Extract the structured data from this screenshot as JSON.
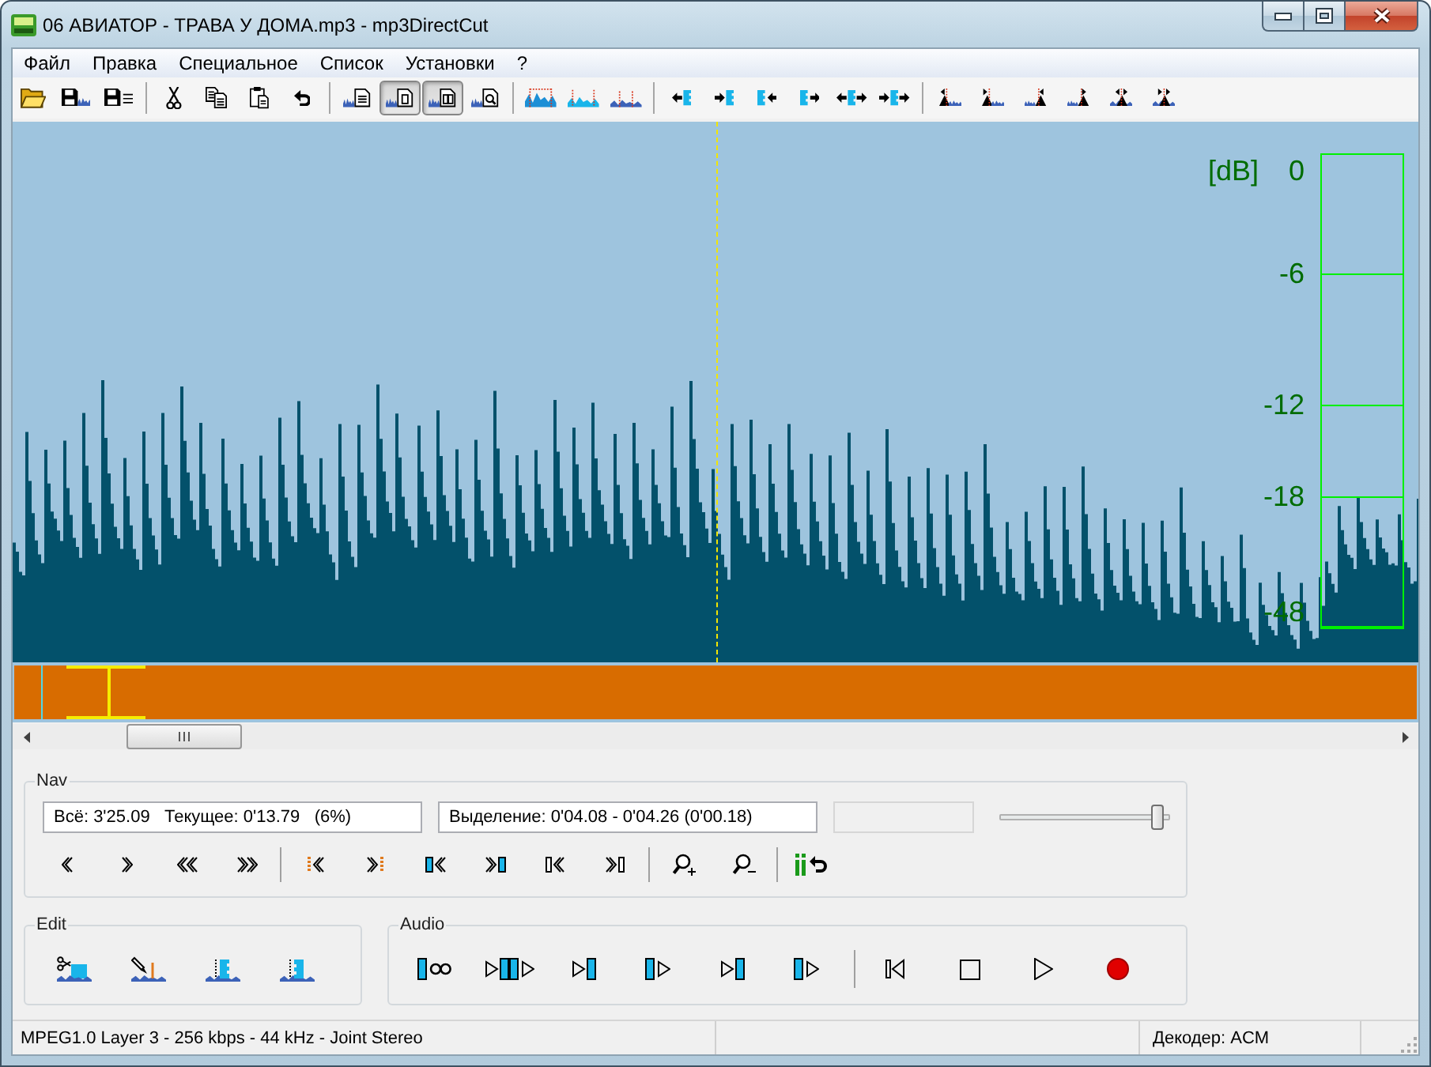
{
  "window": {
    "title": "06 АВИАТОР - ТРАВА У ДОМА.mp3 - mp3DirectCut"
  },
  "menu": [
    "Файл",
    "Правка",
    "Специальное",
    "Список",
    "Установки",
    "?"
  ],
  "toolbar": [
    {
      "buttons": [
        {
          "pressed": false
        },
        {
          "pressed": false
        },
        {
          "pressed": false
        }
      ]
    },
    {
      "buttons": [
        {
          "pressed": false
        },
        {
          "pressed": false
        },
        {
          "pressed": false
        },
        {
          "pressed": false
        }
      ]
    },
    {
      "buttons": [
        {
          "pressed": false
        },
        {
          "pressed": true
        },
        {
          "pressed": true
        },
        {
          "pressed": false
        }
      ]
    },
    {
      "buttons": [
        {
          "pressed": false
        },
        {
          "pressed": false
        },
        {
          "pressed": false
        }
      ]
    },
    {
      "buttons": [
        {
          "pressed": false
        },
        {
          "pressed": false
        },
        {
          "pressed": false
        },
        {
          "pressed": false
        },
        {
          "pressed": false
        },
        {
          "pressed": false
        }
      ]
    },
    {
      "buttons": [
        {
          "pressed": false
        },
        {
          "pressed": false
        },
        {
          "pressed": false
        },
        {
          "pressed": false
        },
        {
          "pressed": false
        },
        {
          "pressed": false
        }
      ]
    }
  ],
  "level_meter": {
    "unit": "[dB]",
    "scale": [
      "0",
      "-6",
      "-12",
      "-18",
      "-48"
    ]
  },
  "nav": {
    "title": "Nav",
    "position": "Всё: 3'25.09   Текущее: 0'13.79   (6%)",
    "selection": "Выделение: 0'04.08 - 0'04.26 (0'00.18)",
    "slider": {
      "level": 0.96
    }
  },
  "edit": {
    "title": "Edit"
  },
  "audio": {
    "title": "Audio"
  },
  "status_bar": {
    "format": "MPEG1.0 Layer 3 - 256 kbps - 44 kHz - Joint Stereo",
    "decoder": "Декодер: ACM"
  }
}
